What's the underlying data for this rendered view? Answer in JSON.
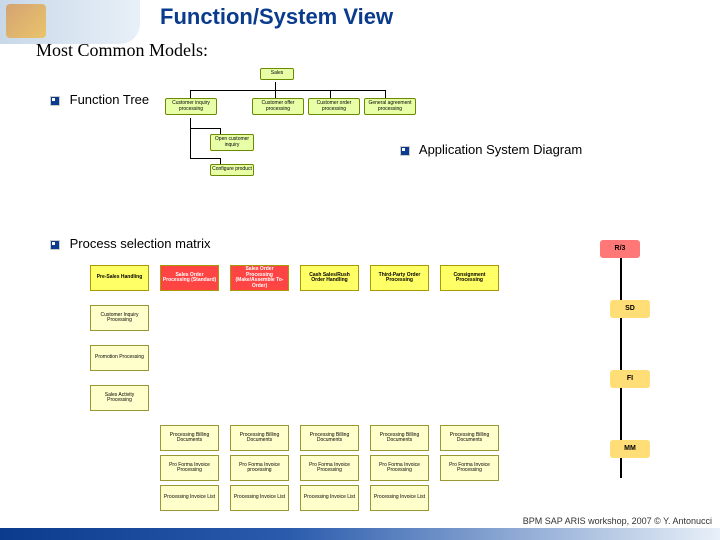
{
  "title": "Function/System View",
  "subtitle": "Most Common Models:",
  "bullets": {
    "function_tree": "Function Tree",
    "app_system": "Application System Diagram",
    "psm": "Process selection matrix"
  },
  "function_tree": {
    "root": "Sales",
    "l1": [
      "Customer inquiry processing",
      "Customer offer processing",
      "Customer order processing",
      "General agreement processing"
    ],
    "l2": [
      "Open customer inquiry",
      "Configure product"
    ]
  },
  "app_system": {
    "items": [
      {
        "label": "R/3",
        "color": "#ff5555"
      },
      {
        "label": "SD",
        "color": "#ffdd55"
      },
      {
        "label": "FI",
        "color": "#ffdd55"
      },
      {
        "label": "MM",
        "color": "#ffdd55"
      }
    ]
  },
  "psm": {
    "row1": [
      "Pre-Sales Handling",
      "Sales Order Processing (Standard)",
      "Sales Order Processing (Make/Assemble To-Order)",
      "Cash Sales/Rush Order Handling",
      "Third-Party Order Processing",
      "Consignment Processing"
    ],
    "row1_sel": [
      false,
      true,
      true,
      false,
      false,
      false
    ],
    "col_labels": [
      "Customer Inquiry Processing",
      "Promotion Processing",
      "Sales Activity Processing"
    ],
    "grid_r1": [
      "Processing Billing Documents",
      "Processing Billing Documents",
      "Processing Billing Documents",
      "Processing Billing Documents",
      "Processing Billing Documents"
    ],
    "grid_r2": [
      "Pro Forma Invoice Processing",
      "Pro Forma Invoice processing",
      "Pro Forma Invoice Processing",
      "Pro Forma Invoice Processing",
      "Pro Forma Invoice Processing"
    ],
    "grid_r3": [
      "Processing Invoice List",
      "Processing Invoice List",
      "Processing Invoice List",
      "Processing Invoice List"
    ]
  },
  "footer": "BPM SAP ARIS workshop, 2007 © Y. Antonucci"
}
